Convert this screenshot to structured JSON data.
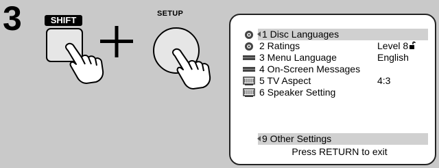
{
  "step_number": "3",
  "buttons": {
    "shift_label": "SHIFT",
    "setup_label": "SETUP"
  },
  "menu": {
    "items": [
      {
        "label": "1 Disc Languages",
        "value": "",
        "icon": "disc-icon",
        "highlighted": true
      },
      {
        "label": "2 Ratings",
        "value": "Level 8",
        "icon": "disc-icon",
        "lock": "padlock-open-icon"
      },
      {
        "label": "3 Menu Language",
        "value": "English",
        "icon": "player-icon"
      },
      {
        "label": "4 On-Screen Messages",
        "value": "",
        "icon": "player-icon"
      },
      {
        "label": "5 TV Aspect",
        "value": "4:3",
        "icon": "tv-icon"
      },
      {
        "label": "6 Speaker Setting",
        "value": "",
        "icon": "tv-icon"
      }
    ],
    "other_settings": "9 Other Settings",
    "exit_hint": "Press RETURN to exit"
  }
}
